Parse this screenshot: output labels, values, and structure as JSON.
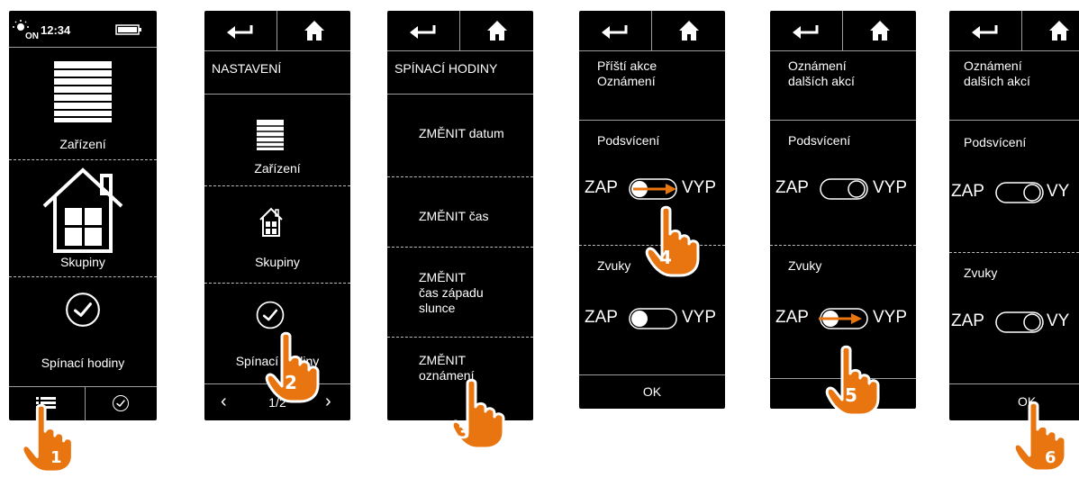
{
  "screens": [
    {
      "status": {
        "time": "12:34"
      },
      "menu": {
        "devices": "Zařízení",
        "groups": "Skupiny",
        "timers": "Spínací hodiny"
      }
    },
    {
      "title": "NASTAVENÍ",
      "items": {
        "devices": "Zařízení",
        "groups": "Skupiny",
        "timers": "Spínací hodiny"
      },
      "pager": "1/2"
    },
    {
      "title": "SPÍNACÍ HODINY",
      "items": [
        "ZMĚNIT datum",
        "ZMĚNIT čas",
        "ZMĚNIT\nčas západu\nslunce",
        "ZMĚNIT\noznámení"
      ]
    },
    {
      "notice": "Příští akce\nOznámení",
      "backlight": "Podsvícení",
      "sounds": "Zvuky",
      "on": "ZAP",
      "off": "VYP",
      "ok": "OK"
    },
    {
      "notice": "Oznámení\ndalších akcí",
      "backlight": "Podsvícení",
      "sounds": "Zvuky",
      "on": "ZAP",
      "off": "VYP"
    },
    {
      "notice": "Oznámení\ndalších akcí",
      "backlight": "Podsvícení",
      "sounds": "Zvuky",
      "on": "ZAP",
      "off": "VY",
      "ok": "OK"
    }
  ],
  "steps": [
    "1",
    "2",
    "3",
    "4",
    "5",
    "6"
  ],
  "colors": {
    "accent": "#e8750f",
    "screen_bg": "#000000",
    "line": "#bdbdbd"
  }
}
